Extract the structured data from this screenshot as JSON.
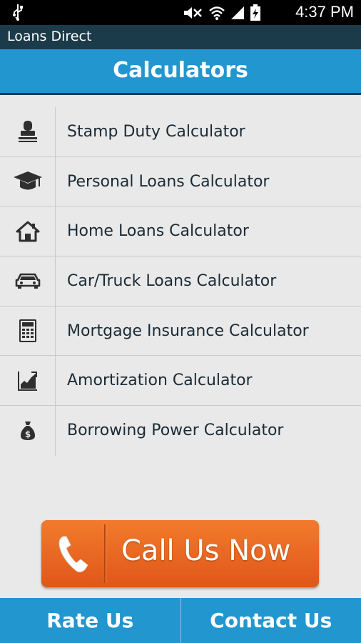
{
  "status_bar": {
    "time": "4:37 PM",
    "icons": [
      "usb-icon",
      "mute-icon",
      "wifi-icon",
      "signal-icon",
      "battery-charging-icon"
    ]
  },
  "app_bar": {
    "title": "Loans Direct"
  },
  "header": {
    "title": "Calculators"
  },
  "calculators": [
    {
      "label": "Stamp Duty Calculator",
      "icon": "stamp-icon"
    },
    {
      "label": "Personal Loans Calculator",
      "icon": "graduation-cap-icon"
    },
    {
      "label": "Home Loans Calculator",
      "icon": "house-icon"
    },
    {
      "label": "Car/Truck Loans Calculator",
      "icon": "car-icon"
    },
    {
      "label": "Mortgage Insurance Calculator",
      "icon": "calculator-icon"
    },
    {
      "label": "Amortization Calculator",
      "icon": "chart-icon"
    },
    {
      "label": "Borrowing Power Calculator",
      "icon": "money-bag-icon"
    }
  ],
  "call_button": {
    "label": "Call Us Now",
    "icon": "phone-icon"
  },
  "bottom_bar": {
    "rate_label": "Rate Us",
    "contact_label": "Contact Us"
  },
  "colors": {
    "accent": "#2196cf",
    "dark": "#1b3a4a",
    "call": "#e9661f"
  }
}
